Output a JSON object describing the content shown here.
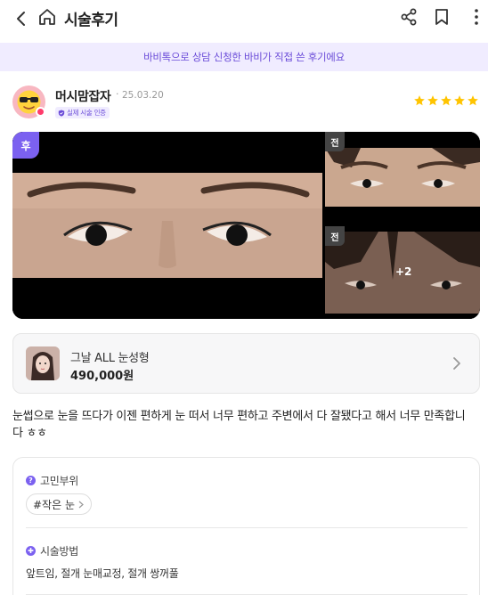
{
  "header": {
    "title": "시술후기",
    "back_icon": "chevron-left-icon",
    "home_icon": "home-icon",
    "share_icon": "share-icon",
    "bookmark_icon": "bookmark-icon",
    "more_icon": "more-vertical-icon"
  },
  "notice": {
    "text": "바비톡으로 상담 신청한 바비가 직접 쓴 후기에요"
  },
  "review_author": {
    "nickname": "머시맘잡자",
    "separator": "·",
    "date": "25.03.20",
    "verified_label": "실제 시술 인증",
    "rating": 5,
    "star_color": "#ffc400"
  },
  "photos": {
    "after_label": "후",
    "before_label": "전",
    "more_count": "+2"
  },
  "product": {
    "name": "그날 ALL 눈성형",
    "price": "490,000원"
  },
  "review": {
    "text": "눈썹으로 눈을 뜨다가 이젠 편하게 눈 떠서 너무 편하고 주변에서 다 잘됐다고 해서 너무 만족합니다 ㅎㅎ"
  },
  "details": {
    "concern_title": "고민부위",
    "concern_tag": "#작은 눈",
    "method_title": "시술방법",
    "method_text": "앞트임, 절개 눈매교정, 절개 쌍꺼풀"
  },
  "colors": {
    "accent": "#7b61f0",
    "notice_bg": "#f0ecff",
    "notice_text": "#6a4bd8"
  }
}
